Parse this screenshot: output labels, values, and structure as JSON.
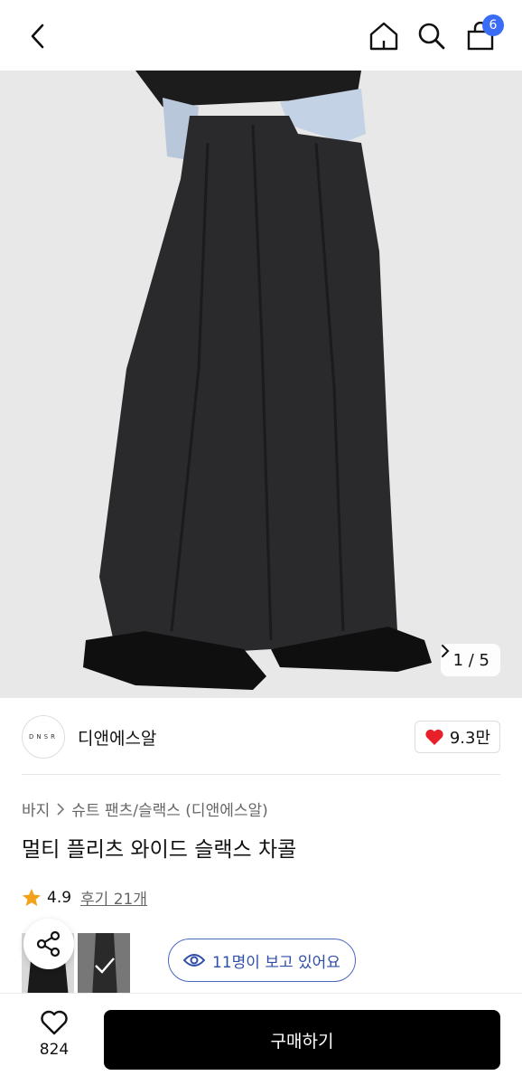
{
  "header": {
    "cart_count": "6",
    "icons": [
      "back-icon",
      "home-icon",
      "search-icon",
      "shopping-bag-icon"
    ]
  },
  "gallery": {
    "pager": "1 / 5"
  },
  "brand": {
    "logo_text": "DNSR",
    "name": "디앤에스알",
    "likes": "9.3만"
  },
  "product": {
    "breadcrumb": [
      "바지",
      "슈트 팬츠/슬랙스 (디앤에스알)"
    ],
    "title": "멀티 플리츠 와이드 슬랙스 차콜",
    "rating": "4.9",
    "review_link": "후기 21개",
    "viewers": "11명이 보고 있어요"
  },
  "bottom": {
    "wish_count": "824",
    "buy_label": "구매하기"
  },
  "colors": {
    "accent": "#3b6cf5",
    "heart": "#e8202a",
    "star": "#f3a21b",
    "viewer_blue": "#2f4ea8"
  }
}
